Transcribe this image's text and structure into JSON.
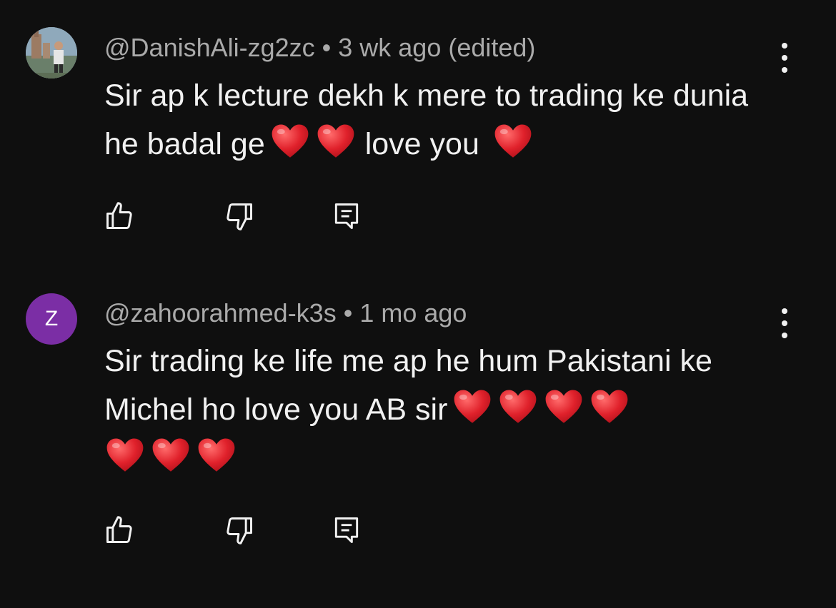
{
  "comments": [
    {
      "author": "@DanishAli-zg2zc",
      "separator": "•",
      "time": "3 wk ago (edited)",
      "avatar": "profile-photo",
      "text_before": "Sir ap k lecture dekh k mere to trading ke dunia he badal ge",
      "text_middle": "love you",
      "hearts_inline": 2,
      "hearts_end": 1,
      "actions": [
        "like-icon",
        "dislike-icon",
        "reply-icon"
      ]
    },
    {
      "author": "@zahoorahmed-k3s",
      "separator": "•",
      "time": "1 mo ago",
      "avatar_letter": "Z",
      "avatar_color": "#7b2ea5",
      "text_before": "Sir trading ke life me ap he hum Pakistani ke Michel ho love you AB sir",
      "hearts_end": 7,
      "actions": [
        "like-icon",
        "dislike-icon",
        "reply-icon"
      ]
    }
  ],
  "colors": {
    "background": "#0f0f0f",
    "text": "#f1f1f1",
    "meta": "#aaaaaa",
    "heart": "#e0212b"
  }
}
